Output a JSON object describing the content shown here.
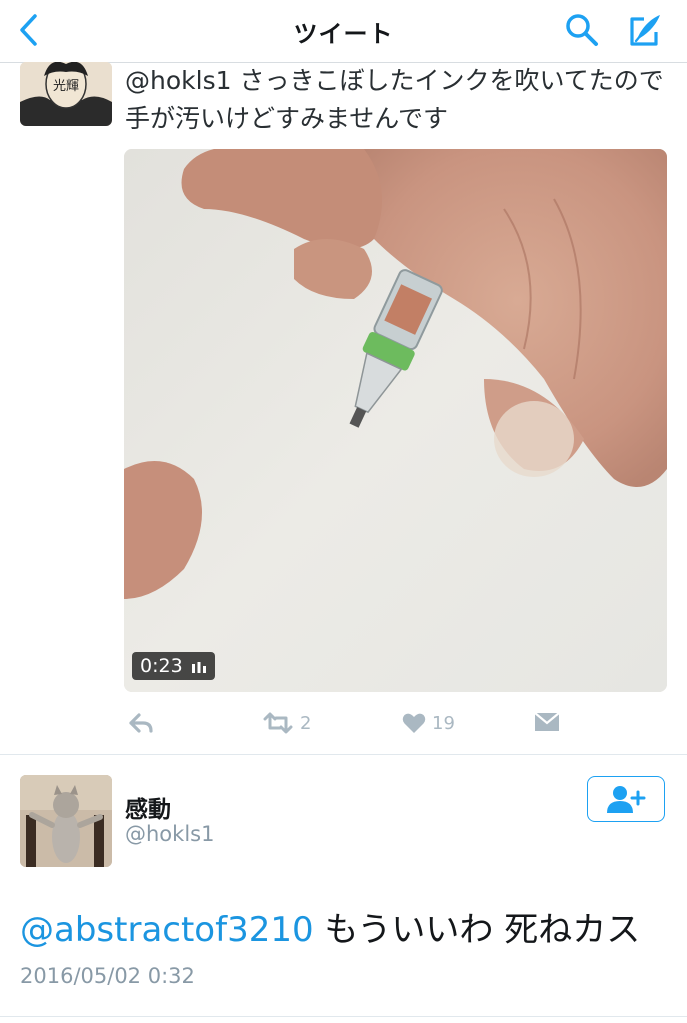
{
  "header": {
    "title": "ツイート",
    "accent_color": "#1da1f2"
  },
  "tweet1": {
    "handle": "@hokls1",
    "text": " さっきこぼしたインクを吹いてたので手が汚いけどすみませんです",
    "avatar_text": "光輝",
    "video_duration": "0:23",
    "retweet_count": "2",
    "like_count": "19"
  },
  "tweet2": {
    "display_name": "感動",
    "handle": "@hokls1",
    "mention": "@abstractof3210",
    "text": " もういいわ 死ねカス",
    "timestamp": "2016/05/02 0:32"
  },
  "icons": {
    "back": "chevron-left-icon",
    "search": "search-icon",
    "compose": "compose-icon",
    "reply": "reply-icon",
    "retweet": "retweet-icon",
    "like": "heart-icon",
    "dm": "envelope-icon",
    "follow": "add-user-icon",
    "stats": "stats-icon"
  }
}
